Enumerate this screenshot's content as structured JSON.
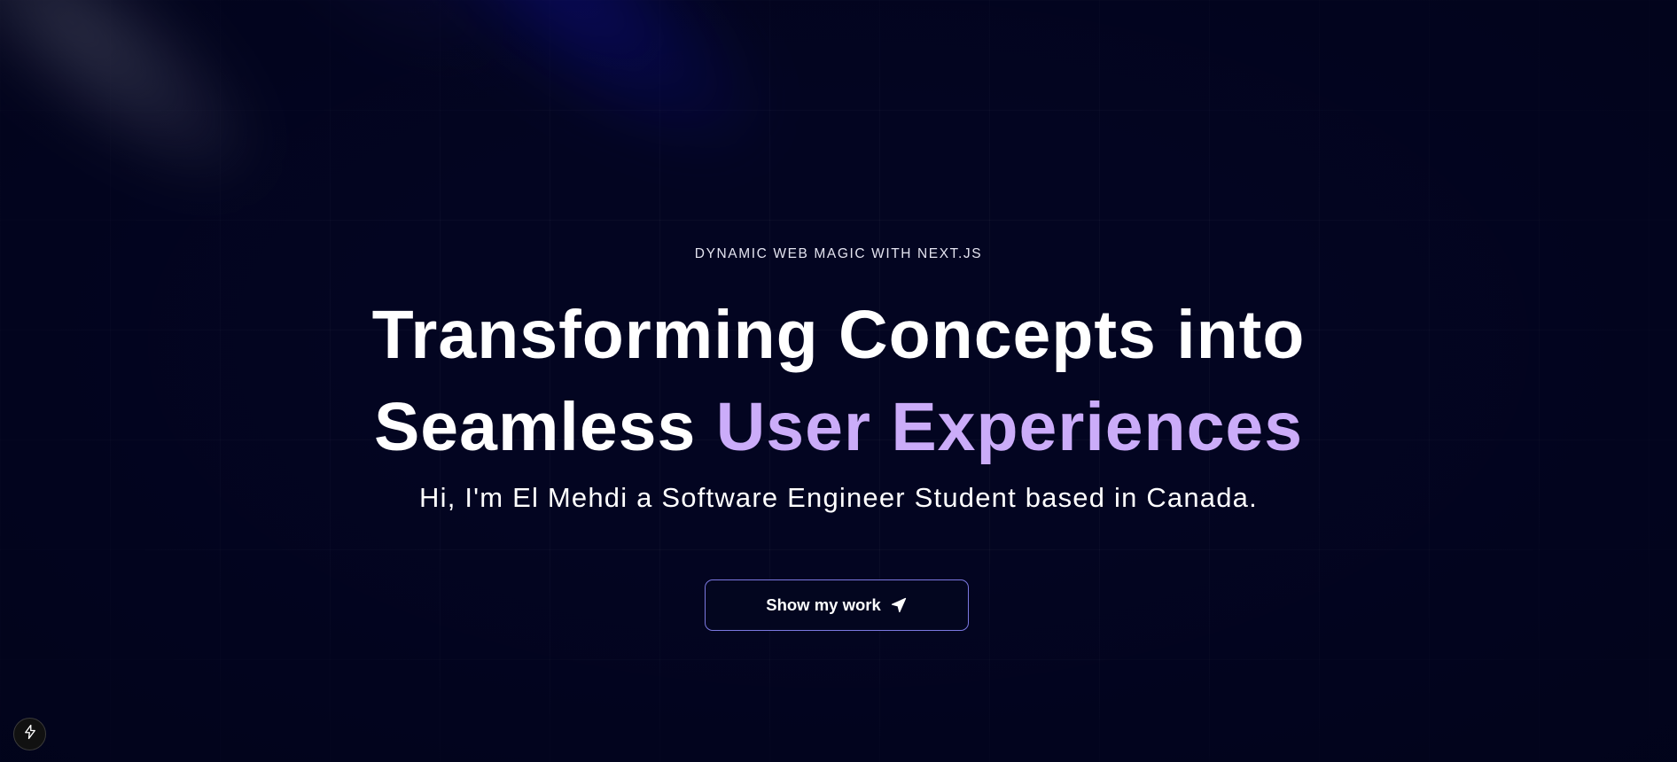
{
  "hero": {
    "eyebrow": "Dynamic Web Magic with Next.js",
    "headline_line1": "Transforming Concepts into",
    "headline_line2_plain": "Seamless",
    "headline_line2_accent": "User Experiences",
    "subtitle": "Hi, I'm El Mehdi a Software Engineer Student based in Canada.",
    "cta_label": "Show my work",
    "cta_icon": "paper-plane-icon"
  },
  "dev_indicator": {
    "icon": "lightning-bolt-icon"
  },
  "colors": {
    "background": "#000319",
    "accent": "#cbacf9",
    "button_border": "#7b78e0",
    "text": "#ffffff"
  }
}
